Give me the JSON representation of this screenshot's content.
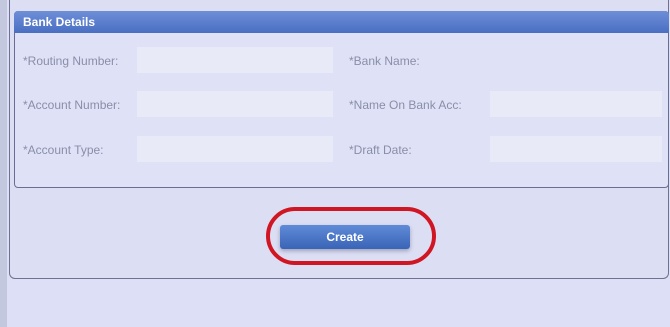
{
  "section": {
    "title": "Bank Details"
  },
  "fields": {
    "routing_number": {
      "label": "*Routing Number:",
      "value": ""
    },
    "bank_name": {
      "label": "*Bank Name:",
      "value": ""
    },
    "account_number": {
      "label": "*Account Number:",
      "value": ""
    },
    "name_on_bank_acc": {
      "label": "*Name On Bank Acc:",
      "value": ""
    },
    "account_type": {
      "label": "*Account Type:",
      "value": ""
    },
    "draft_date": {
      "label": "*Draft Date:",
      "value": ""
    }
  },
  "actions": {
    "create_label": "Create"
  },
  "colors": {
    "header": "#5a7ccc",
    "button": "#4a74c6",
    "highlight_ring": "#d01622",
    "background": "#dcdff5"
  }
}
